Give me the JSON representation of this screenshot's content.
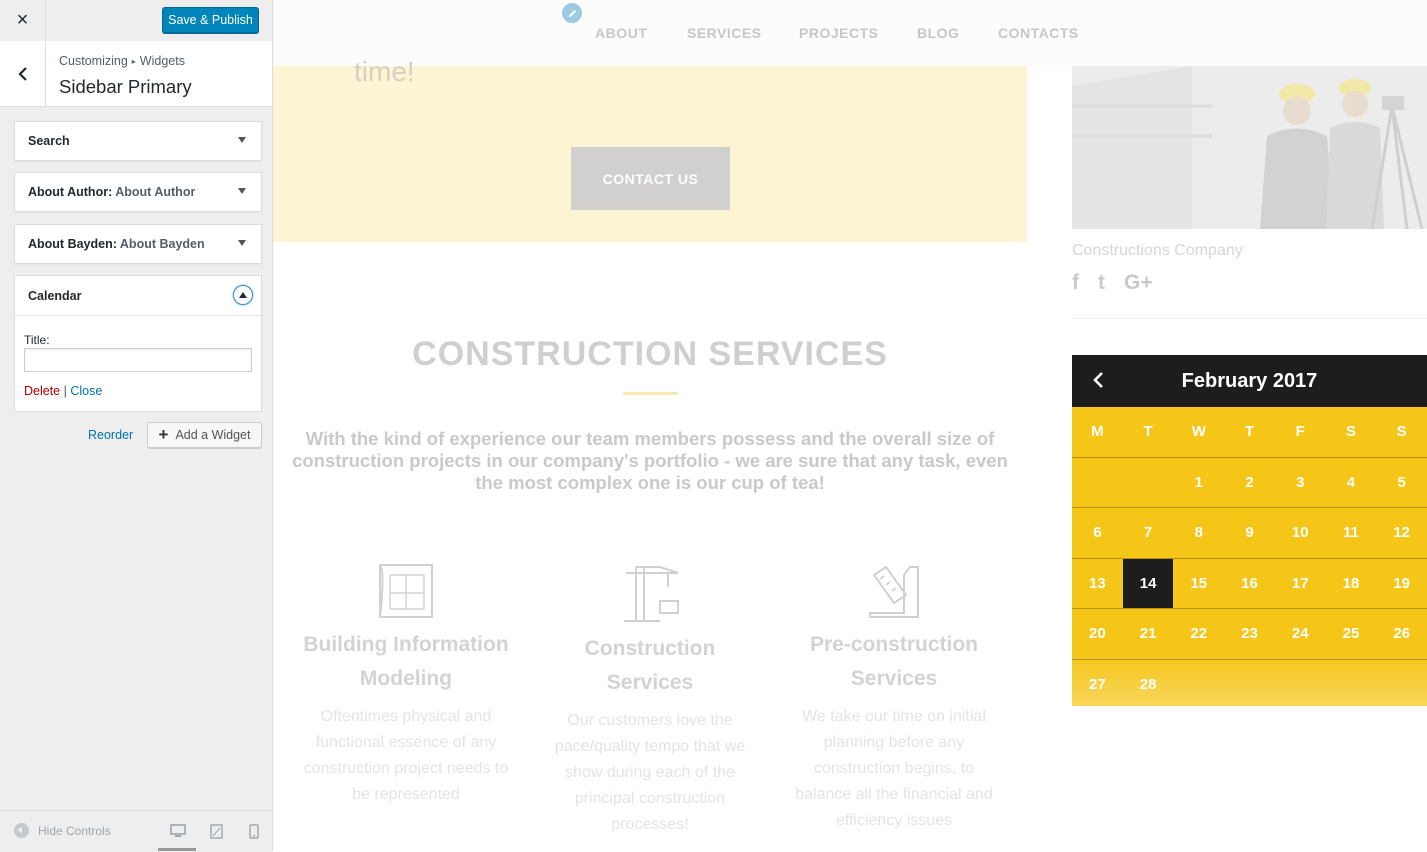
{
  "customizer": {
    "close_glyph": "×",
    "publish_label": "Save & Publish",
    "breadcrumb": {
      "root": "Customizing",
      "sep": "▸",
      "current": "Widgets"
    },
    "section_title": "Sidebar Primary",
    "widgets": [
      {
        "name": "Search",
        "subtitle": ""
      },
      {
        "name": "About Author:",
        "subtitle": "About Author"
      },
      {
        "name": "About Bayden:",
        "subtitle": "About Bayden"
      }
    ],
    "open_widget": {
      "name": "Calendar",
      "title_label": "Title:",
      "title_value": "",
      "delete_label": "Delete",
      "separator": "|",
      "close_label": "Close"
    },
    "reorder_label": "Reorder",
    "add_widget_plus": "+",
    "add_widget_label": "Add a Widget",
    "hide_controls_label": "Hide Controls",
    "devices": [
      "desktop-icon",
      "tablet-icon",
      "mobile-icon"
    ]
  },
  "preview": {
    "nav": [
      "ABOUT",
      "SERVICES",
      "PROJECTS",
      "BLOG",
      "CONTACTS"
    ],
    "cta_partial_text": "time!",
    "contact_button": "CONTACT US",
    "company_name": "Constructions Company",
    "socials": [
      "f",
      "t",
      "G+"
    ],
    "services": {
      "title": "CONSTRUCTION SERVICES",
      "intro": "With the kind of experience our team members possess and the overall size of construction projects in our company's portfolio - we are sure that any task, even the most complex one is our cup of tea!",
      "cards": [
        {
          "icon": "blueprint-icon",
          "title": "Building Information Modeling",
          "text": "Oftentimes physical and functional essence of any construction project needs to be represented"
        },
        {
          "icon": "crane-icon",
          "title": "Construction Services",
          "text": "Our customers love the pace/quality tempo that we show during each of the principal construction processes!"
        },
        {
          "icon": "ruler-icon",
          "title": "Pre-construction Services",
          "text": "We take our time on initial planning before any construction begins, to balance all the financial and efficiency issues"
        }
      ]
    },
    "calendar": {
      "month": "February 2017",
      "prev_glyph": "‹",
      "weekdays": [
        "M",
        "T",
        "W",
        "T",
        "F",
        "S",
        "S"
      ],
      "weeks": [
        [
          "",
          "",
          "1",
          "2",
          "3",
          "4",
          "5"
        ],
        [
          "6",
          "7",
          "8",
          "9",
          "10",
          "11",
          "12"
        ],
        [
          "13",
          "14",
          "15",
          "16",
          "17",
          "18",
          "19"
        ],
        [
          "20",
          "21",
          "22",
          "23",
          "24",
          "25",
          "26"
        ],
        [
          "27",
          "28",
          "",
          "",
          "",
          "",
          ""
        ]
      ],
      "today": "14"
    }
  },
  "colors": {
    "primary_button": "#0085ba",
    "calendar_yellow": "#f5c518",
    "calendar_dark": "#1d1d1d",
    "cta_bg": "#fdf4d3",
    "delete_red": "#aa0000",
    "link_blue": "#0073aa"
  }
}
